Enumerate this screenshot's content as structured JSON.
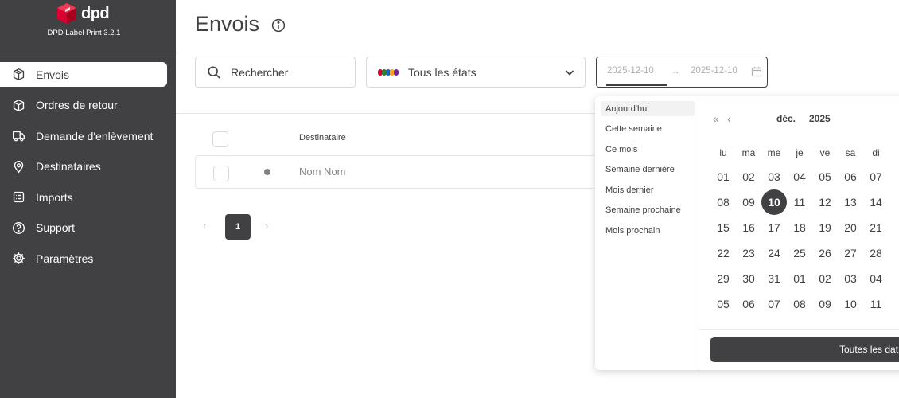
{
  "app": {
    "logo_text": "dpd",
    "version": "DPD Label Print 3.2.1",
    "brand_color": "#dc0032"
  },
  "sidebar": {
    "items": [
      {
        "label": "Envois",
        "icon": "package-icon",
        "active": true
      },
      {
        "label": "Ordres de retour",
        "icon": "return-package-icon",
        "active": false
      },
      {
        "label": "Demande d'enlèvement",
        "icon": "truck-icon",
        "active": false
      },
      {
        "label": "Destinataires",
        "icon": "location-pin-icon",
        "active": false
      },
      {
        "label": "Imports",
        "icon": "list-icon",
        "active": false
      },
      {
        "label": "Support",
        "icon": "help-circle-icon",
        "active": false
      },
      {
        "label": "Paramètres",
        "icon": "gear-icon",
        "active": false
      }
    ]
  },
  "main": {
    "title": "Envois",
    "search": {
      "placeholder": "Rechercher"
    },
    "status_filter": {
      "value": "Tous les états",
      "dot_colors": [
        "#dc0032",
        "#2e7d32",
        "#1565c0",
        "#f9a825",
        "#7b1fa2"
      ]
    },
    "date_range": {
      "start": "2025-12-10",
      "arrow": "→",
      "end": "2025-12-10"
    },
    "table": {
      "columns": [
        "Destinataire"
      ],
      "rows": [
        {
          "recipient": "Nom Nom"
        }
      ]
    },
    "pagination": {
      "prev": "‹",
      "current": "1",
      "next": "›"
    }
  },
  "date_picker": {
    "presets": [
      "Aujourd'hui",
      "Cette semaine",
      "Ce mois",
      "Semaine dernière",
      "Mois dernier",
      "Semaine prochaine",
      "Mois prochain"
    ],
    "active_preset": "Aujourd'hui",
    "nav_prev_year": "«",
    "nav_prev_month": "‹",
    "month": "déc.",
    "year": "2025",
    "weekdays": [
      "lu",
      "ma",
      "me",
      "je",
      "ve",
      "sa",
      "di"
    ],
    "weeks": [
      [
        "01",
        "02",
        "03",
        "04",
        "05",
        "06",
        "07"
      ],
      [
        "08",
        "09",
        "10",
        "11",
        "12",
        "13",
        "14"
      ],
      [
        "15",
        "16",
        "17",
        "18",
        "19",
        "20",
        "21"
      ],
      [
        "22",
        "23",
        "24",
        "25",
        "26",
        "27",
        "28"
      ],
      [
        "29",
        "30",
        "31",
        "01",
        "02",
        "03",
        "04"
      ],
      [
        "05",
        "06",
        "07",
        "08",
        "09",
        "10",
        "11"
      ]
    ],
    "selected_day": "10",
    "all_dates_button": "Toutes les dat"
  }
}
